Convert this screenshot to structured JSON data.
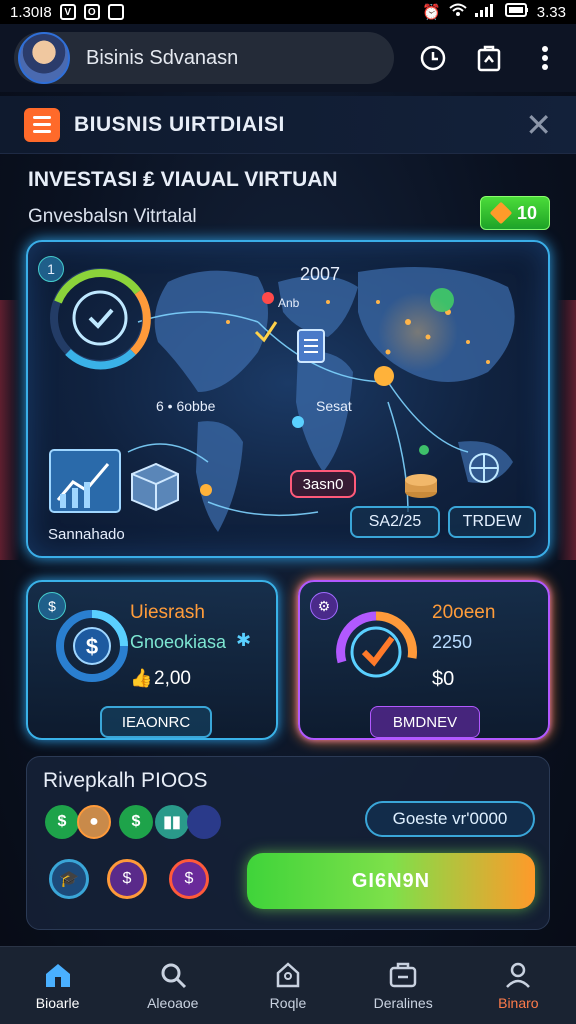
{
  "status_bar": {
    "time_left": "1.30I8",
    "icon_a": "V",
    "icon_b": "O",
    "time_right": "3.33"
  },
  "top_bar": {
    "search_text": "Bisinis Sdvanasn"
  },
  "header": {
    "title": "BIUSNIS UIRTDIAISI"
  },
  "section": {
    "title": "INVESTASI ₤ VIAUAL VIRTUAN",
    "subtitle": "Gnvesbalsn Vitrtalal",
    "badge_value": "10"
  },
  "map_panel": {
    "label_top": "2007",
    "label_city": "Anb",
    "label_left": "6 • 6obbe",
    "label_mid": "Sesat",
    "label_stats": "Sannahado",
    "pill_red": "3asn0",
    "pill_date": "SA2/25",
    "pill_trend": "TRDEW",
    "pin_label": "1"
  },
  "card_left": {
    "title": "Uiesrash",
    "subtitle": "Gnoeokiasa",
    "value": "2,00",
    "button": "IEAONRC"
  },
  "card_right": {
    "title": "20oeen",
    "subtitle": "2250",
    "value": "$0",
    "button": "BMDNEV"
  },
  "bottom_panel": {
    "title": "Rivepkalh PIOOS",
    "outline_button": "Goeste vr'0000",
    "cta_button": "GI6N9N"
  },
  "nav": {
    "items": [
      {
        "label": "Bioarle"
      },
      {
        "label": "Aleoaoe"
      },
      {
        "label": "Roqle"
      },
      {
        "label": "Deralines"
      },
      {
        "label": "Binaro"
      }
    ]
  }
}
